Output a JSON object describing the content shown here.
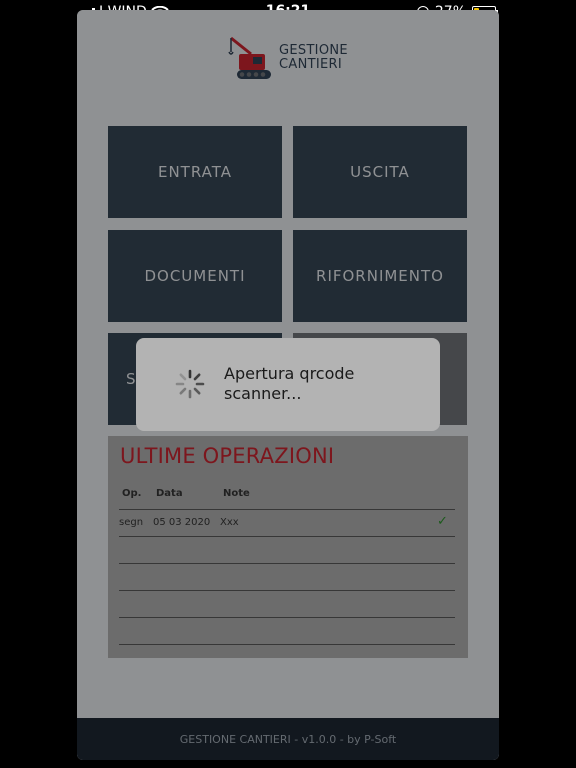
{
  "status_bar": {
    "carrier": "I WIND",
    "time": "16:21",
    "battery": "27%",
    "battery_level": 0.27
  },
  "app": {
    "logo_line1": "GESTIONE",
    "logo_line2": "CANTIERI",
    "tiles": {
      "entrata": "ENTRATA",
      "uscita": "USCITA",
      "documenti": "DOCUMENTI",
      "rifornimento": "RIFORNIMENTO",
      "partial": "S"
    },
    "operations": {
      "title": "ULTIME OPERAZIONI",
      "headers": [
        "Op.",
        "Data",
        "Note"
      ],
      "rows": [
        {
          "op": "segn",
          "data": "05 03 2020",
          "note": "Xxx",
          "status": "check-icon"
        }
      ]
    },
    "footer": "GESTIONE CANTIERI - v1.0.0 - by P-Soft"
  },
  "dialog": {
    "message": "Apertura qrcode scanner..."
  },
  "colors": {
    "tile": "#344251",
    "title_red": "#c0232d",
    "footer": "#1c2530"
  }
}
